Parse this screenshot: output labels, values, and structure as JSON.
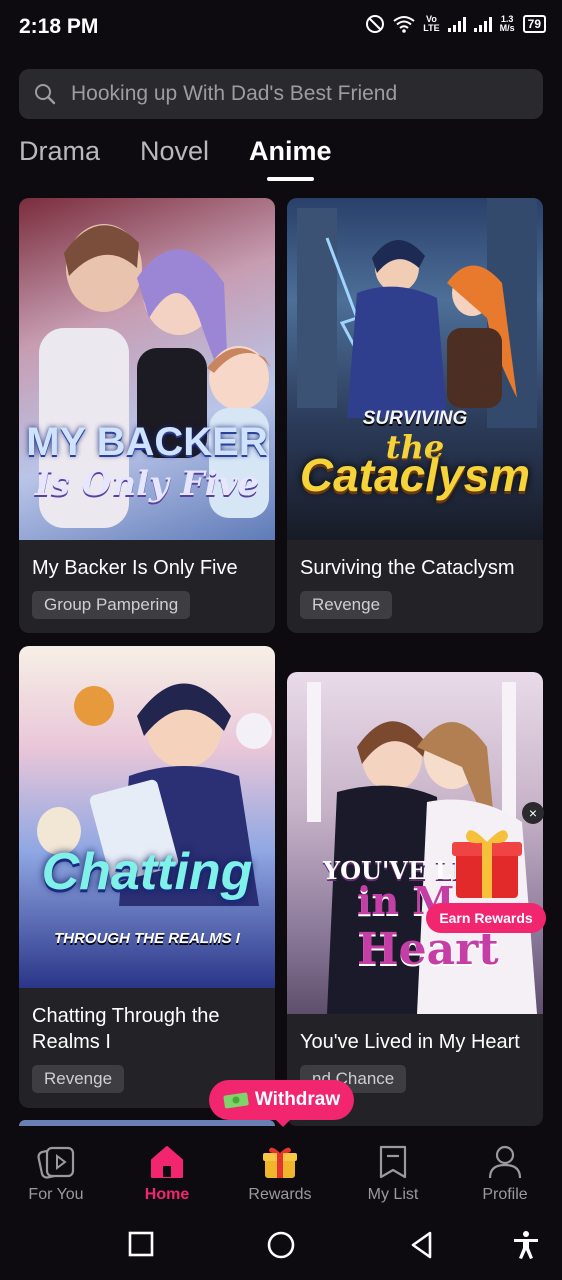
{
  "status": {
    "time": "2:18 PM",
    "network_top": "Vo",
    "network_bottom": "LTE",
    "speed_top": "1.3",
    "speed_bottom": "M/s",
    "battery": "79"
  },
  "search": {
    "placeholder": "Hooking up With Dad's Best Friend"
  },
  "tabs": [
    {
      "label": "Drama"
    },
    {
      "label": "Novel"
    },
    {
      "label": "Anime",
      "active": true
    }
  ],
  "cards": [
    {
      "title": "My Backer Is Only Five",
      "tag": "Group Pampering",
      "cover_line1": "MY BACKER",
      "cover_line2": "Is Only Five"
    },
    {
      "title": "Surviving the Cataclysm",
      "tag": "Revenge",
      "cover_line1": "SURVIVING",
      "cover_line2": "the",
      "cover_line3": "Cataclysm"
    },
    {
      "title": "Chatting Through the Realms I",
      "tag": "Revenge",
      "cover_line1": "Chatting",
      "cover_line2": "THROUGH THE REALMS I"
    },
    {
      "title": "You've Lived in My Heart",
      "tag": "nd Chance",
      "cover_line1": "YOU'VE LI",
      "cover_line2": "in M",
      "cover_line3": "Heart"
    }
  ],
  "promo": {
    "earn_rewards": "Earn Rewards",
    "close": "×",
    "withdraw": "Withdraw"
  },
  "nav": [
    {
      "label": "For You",
      "icon": "play-stack-icon"
    },
    {
      "label": "Home",
      "icon": "home-icon",
      "active": true
    },
    {
      "label": "Rewards",
      "icon": "gift-icon"
    },
    {
      "label": "My List",
      "icon": "bookmark-icon"
    },
    {
      "label": "Profile",
      "icon": "profile-icon"
    }
  ],
  "colors": {
    "accent": "#f2266f",
    "background": "#0d0b10",
    "card": "#232226"
  }
}
